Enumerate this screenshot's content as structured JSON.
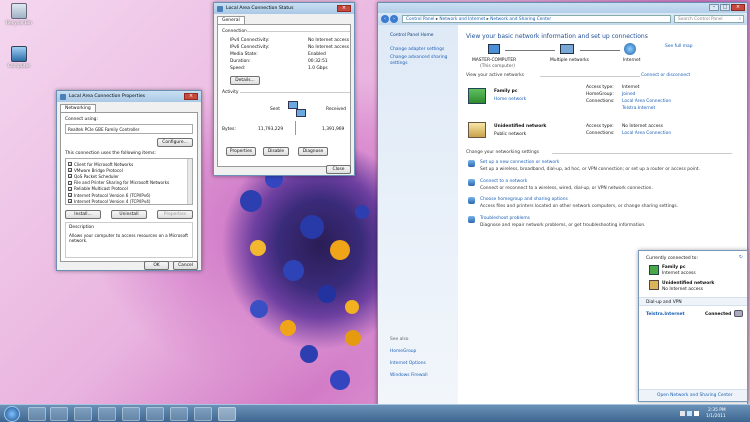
{
  "desktop": {
    "icons": [
      {
        "label": "Recycle Bin"
      },
      {
        "label": "Computer"
      }
    ]
  },
  "lac_props": {
    "title": "Local Area Connection Properties",
    "tab": "Networking",
    "connect_using_label": "Connect using:",
    "adapter": "Realtek PCIe GBE Family Controller",
    "configure_btn": "Configure...",
    "items_label": "This connection uses the following items:",
    "items": [
      "Client for Microsoft Networks",
      "VMware Bridge Protocol",
      "QoS Packet Scheduler",
      "File and Printer Sharing for Microsoft Networks",
      "Reliable Multicast Protocol",
      "Internet Protocol Version 6 (TCP/IPv6)",
      "Internet Protocol Version 4 (TCP/IPv4)"
    ],
    "install_btn": "Install...",
    "uninstall_btn": "Uninstall",
    "properties_btn": "Properties",
    "description_label": "Description",
    "description_text": "Allows your computer to access resources on a Microsoft network.",
    "ok_btn": "OK",
    "cancel_btn": "Cancel"
  },
  "lac_status": {
    "title": "Local Area Connection Status",
    "tab": "General",
    "connection_label": "Connection",
    "rows": [
      {
        "k": "IPv4 Connectivity:",
        "v": "No Internet access"
      },
      {
        "k": "IPv6 Connectivity:",
        "v": "No Internet access"
      },
      {
        "k": "Media State:",
        "v": "Enabled"
      },
      {
        "k": "Duration:",
        "v": "00:32:51"
      },
      {
        "k": "Speed:",
        "v": "1.0 Gbps"
      }
    ],
    "details_btn": "Details...",
    "activity_label": "Activity",
    "sent_label": "Sent",
    "received_label": "Received",
    "bytes_label": "Bytes:",
    "bytes_sent": "11,793,229",
    "bytes_received": "1,391,969",
    "properties_btn": "Properties",
    "disable_btn": "Disable",
    "diagnose_btn": "Diagnose",
    "close_btn": "Close"
  },
  "cp": {
    "breadcrumb": [
      "Control Panel",
      "Network and Internet",
      "Network and Sharing Center"
    ],
    "search_placeholder": "Search Control Panel",
    "sidebar": {
      "home": "Control Panel Home",
      "links": [
        "Change adapter settings",
        "Change advanced sharing settings"
      ],
      "see_also": "See also",
      "see_also_links": [
        "HomeGroup",
        "Internet Options",
        "Windows Firewall"
      ]
    },
    "heading": "View your basic network information and set up connections",
    "see_full_map": "See full map",
    "map": {
      "computer": "MASTER-COMPUTER",
      "computer_sub": "(This computer)",
      "middle": "Multiple networks",
      "right": "Internet"
    },
    "active_label": "View your active networks",
    "connect_disconnect": "Connect or disconnect",
    "networks": [
      {
        "name": "Family pc",
        "type": "Home network",
        "access_type": "Internet",
        "homegroup": "Joined",
        "connections": [
          "Local Area Connection",
          "Telstra.Internet"
        ]
      },
      {
        "name": "Unidentified network",
        "type": "Public network",
        "access_type": "No Internet access",
        "connections": [
          "Local Area Connection"
        ]
      }
    ],
    "field_labels": {
      "access": "Access type:",
      "homegroup": "HomeGroup:",
      "connections": "Connections:"
    },
    "change_label": "Change your networking settings",
    "tasks": [
      {
        "title": "Set up a new connection or network",
        "desc": "Set up a wireless, broadband, dial-up, ad hoc, or VPN connection; or set up a router or access point."
      },
      {
        "title": "Connect to a network",
        "desc": "Connect or reconnect to a wireless, wired, dial-up, or VPN network connection."
      },
      {
        "title": "Choose homegroup and sharing options",
        "desc": "Access files and printers located on other network computers, or change sharing settings."
      },
      {
        "title": "Troubleshoot problems",
        "desc": "Diagnose and repair network problems, or get troubleshooting information."
      }
    ]
  },
  "popup": {
    "header": "Currently connected to:",
    "networks": [
      {
        "name": "Family pc",
        "status": "Internet access"
      },
      {
        "name": "Unidentified network",
        "status": "No Internet access"
      }
    ],
    "section": "Dial-up and VPN",
    "vpn_name": "Telstra.Internet",
    "vpn_status": "Connected",
    "footer_link": "Open Network and Sharing Center"
  },
  "taskbar": {
    "time": "2:35 PM",
    "date": "1/1/2011"
  }
}
